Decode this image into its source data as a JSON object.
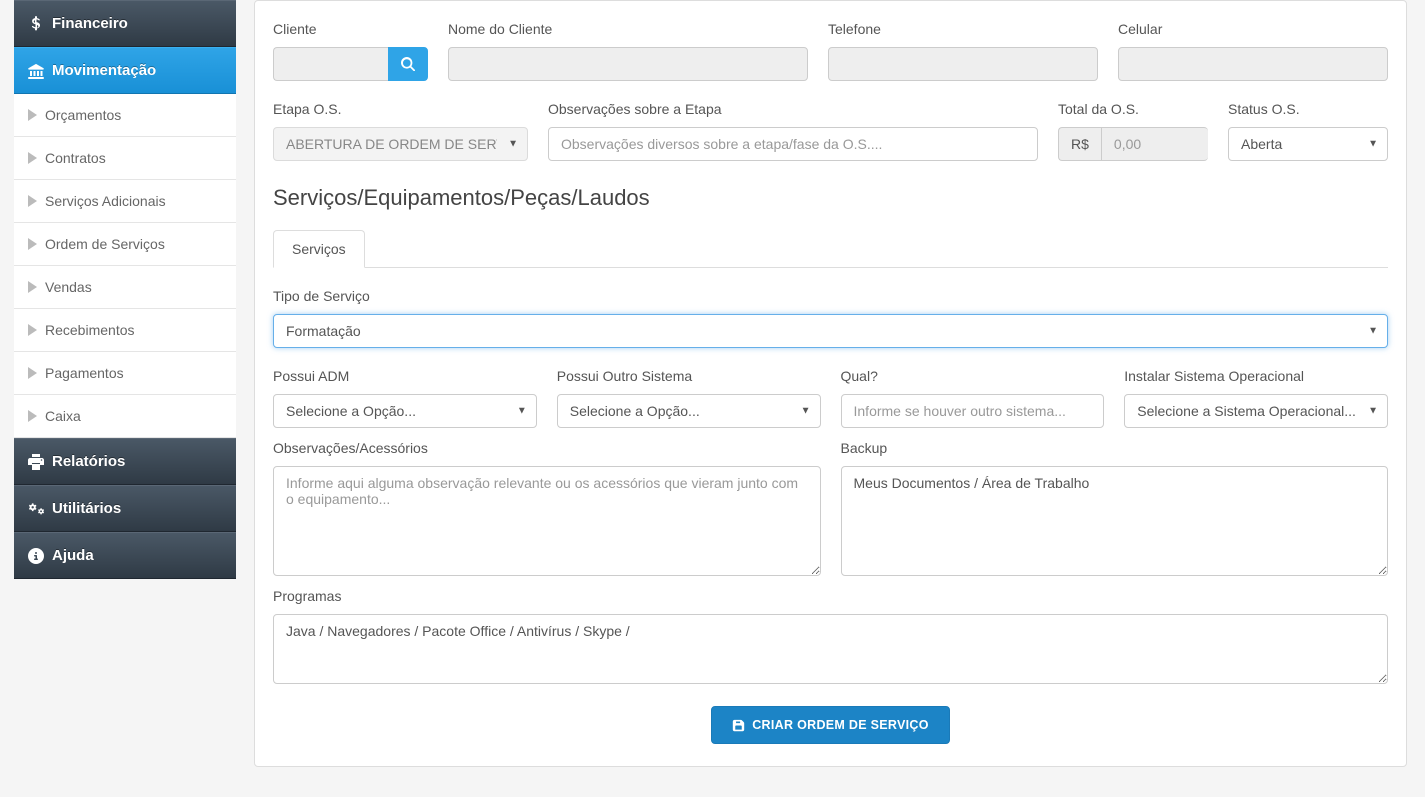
{
  "sidebar": {
    "sections": [
      {
        "id": "financeiro",
        "label": "Financeiro",
        "icon": "dollar"
      },
      {
        "id": "movimentacao",
        "label": "Movimentação",
        "icon": "bank",
        "active": true
      },
      {
        "id": "relatorios",
        "label": "Relatórios",
        "icon": "printer"
      },
      {
        "id": "utilitarios",
        "label": "Utilitários",
        "icon": "gears"
      },
      {
        "id": "ajuda",
        "label": "Ajuda",
        "icon": "info"
      }
    ],
    "movimentacao_items": [
      {
        "label": "Orçamentos"
      },
      {
        "label": "Contratos"
      },
      {
        "label": "Serviços Adicionais"
      },
      {
        "label": "Ordem de Serviços"
      },
      {
        "label": "Vendas"
      },
      {
        "label": "Recebimentos"
      },
      {
        "label": "Pagamentos"
      },
      {
        "label": "Caixa"
      }
    ]
  },
  "form": {
    "cliente_label": "Cliente",
    "nome_cliente_label": "Nome do Cliente",
    "telefone_label": "Telefone",
    "celular_label": "Celular",
    "etapa_label": "Etapa O.S.",
    "etapa_value": "ABERTURA DE ORDEM DE SERVIÇO",
    "obs_etapa_label": "Observações sobre a Etapa",
    "obs_etapa_placeholder": "Observações diversos sobre a etapa/fase da O.S....",
    "total_label": "Total da O.S.",
    "total_prefix": "R$",
    "total_value": "0,00",
    "status_label": "Status O.S.",
    "status_value": "Aberta",
    "section_title": "Serviços/Equipamentos/Peças/Laudos",
    "tab_servicos": "Serviços",
    "tipo_servico_label": "Tipo de Serviço",
    "tipo_servico_value": "Formatação",
    "possui_adm_label": "Possui ADM",
    "possui_adm_value": "Selecione a Opção...",
    "possui_outro_label": "Possui Outro Sistema",
    "possui_outro_value": "Selecione a Opção...",
    "qual_label": "Qual?",
    "qual_placeholder": "Informe se houver outro sistema...",
    "instalar_so_label": "Instalar Sistema Operacional",
    "instalar_so_value": "Selecione a Sistema Operacional...",
    "obs_acessorios_label": "Observações/Acessórios",
    "obs_acessorios_placeholder": "Informe aqui alguma observação relevante ou os acessórios que vieram junto com o equipamento...",
    "backup_label": "Backup",
    "backup_value": "Meus Documentos / Área de Trabalho",
    "programas_label": "Programas",
    "programas_value": "Java / Navegadores / Pacote Office / Antivírus / Skype / ",
    "submit_label": "CRIAR ORDEM DE SERVIÇO"
  }
}
